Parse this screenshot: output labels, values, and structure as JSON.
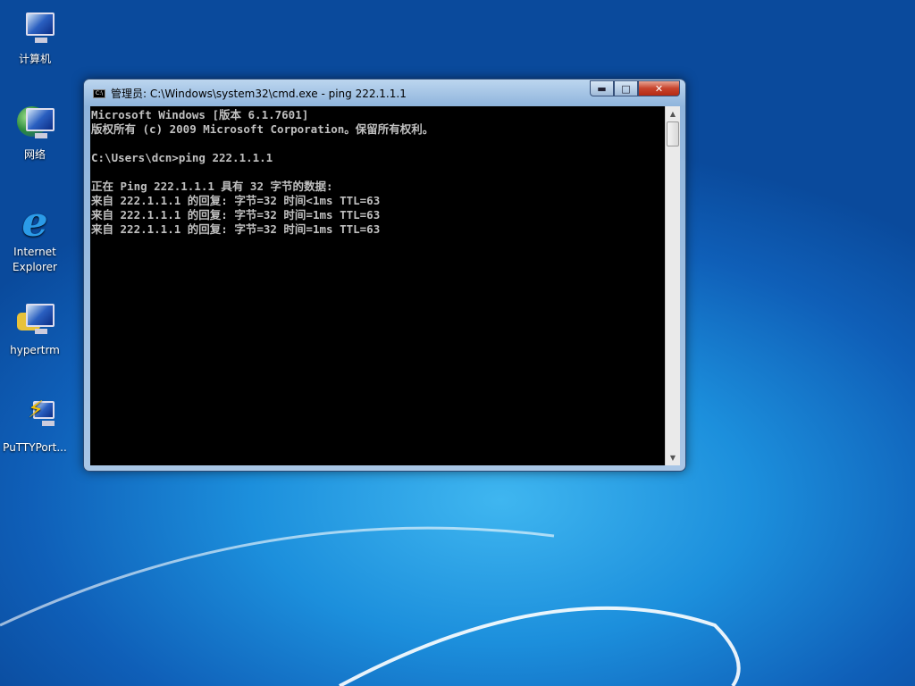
{
  "desktop": {
    "icons": [
      {
        "label": "计算机",
        "icon": "computer-icon"
      },
      {
        "label": "网络",
        "icon": "network-icon"
      },
      {
        "label": "Internet Explorer",
        "icon": "ie-icon"
      },
      {
        "label": "hypertrm",
        "icon": "hyperterminal-icon"
      },
      {
        "label": "PuTTYPort...",
        "icon": "putty-icon"
      }
    ]
  },
  "window": {
    "title": "管理员: C:\\Windows\\system32\\cmd.exe - ping  222.1.1.1",
    "icon_text": "C:\\",
    "buttons": {
      "minimize": "▬",
      "maximize": "□",
      "close": "✕"
    },
    "lines": [
      "Microsoft Windows [版本 6.1.7601]",
      "版权所有 (c) 2009 Microsoft Corporation。保留所有权利。",
      "",
      "C:\\Users\\dcn>ping 222.1.1.1",
      "",
      "正在 Ping 222.1.1.1 具有 32 字节的数据:",
      "来自 222.1.1.1 的回复: 字节=32 时间<1ms TTL=63",
      "来自 222.1.1.1 的回复: 字节=32 时间=1ms TTL=63",
      "来自 222.1.1.1 的回复: 字节=32 时间=1ms TTL=63"
    ],
    "scroll": {
      "up": "▲",
      "down": "▼"
    }
  }
}
